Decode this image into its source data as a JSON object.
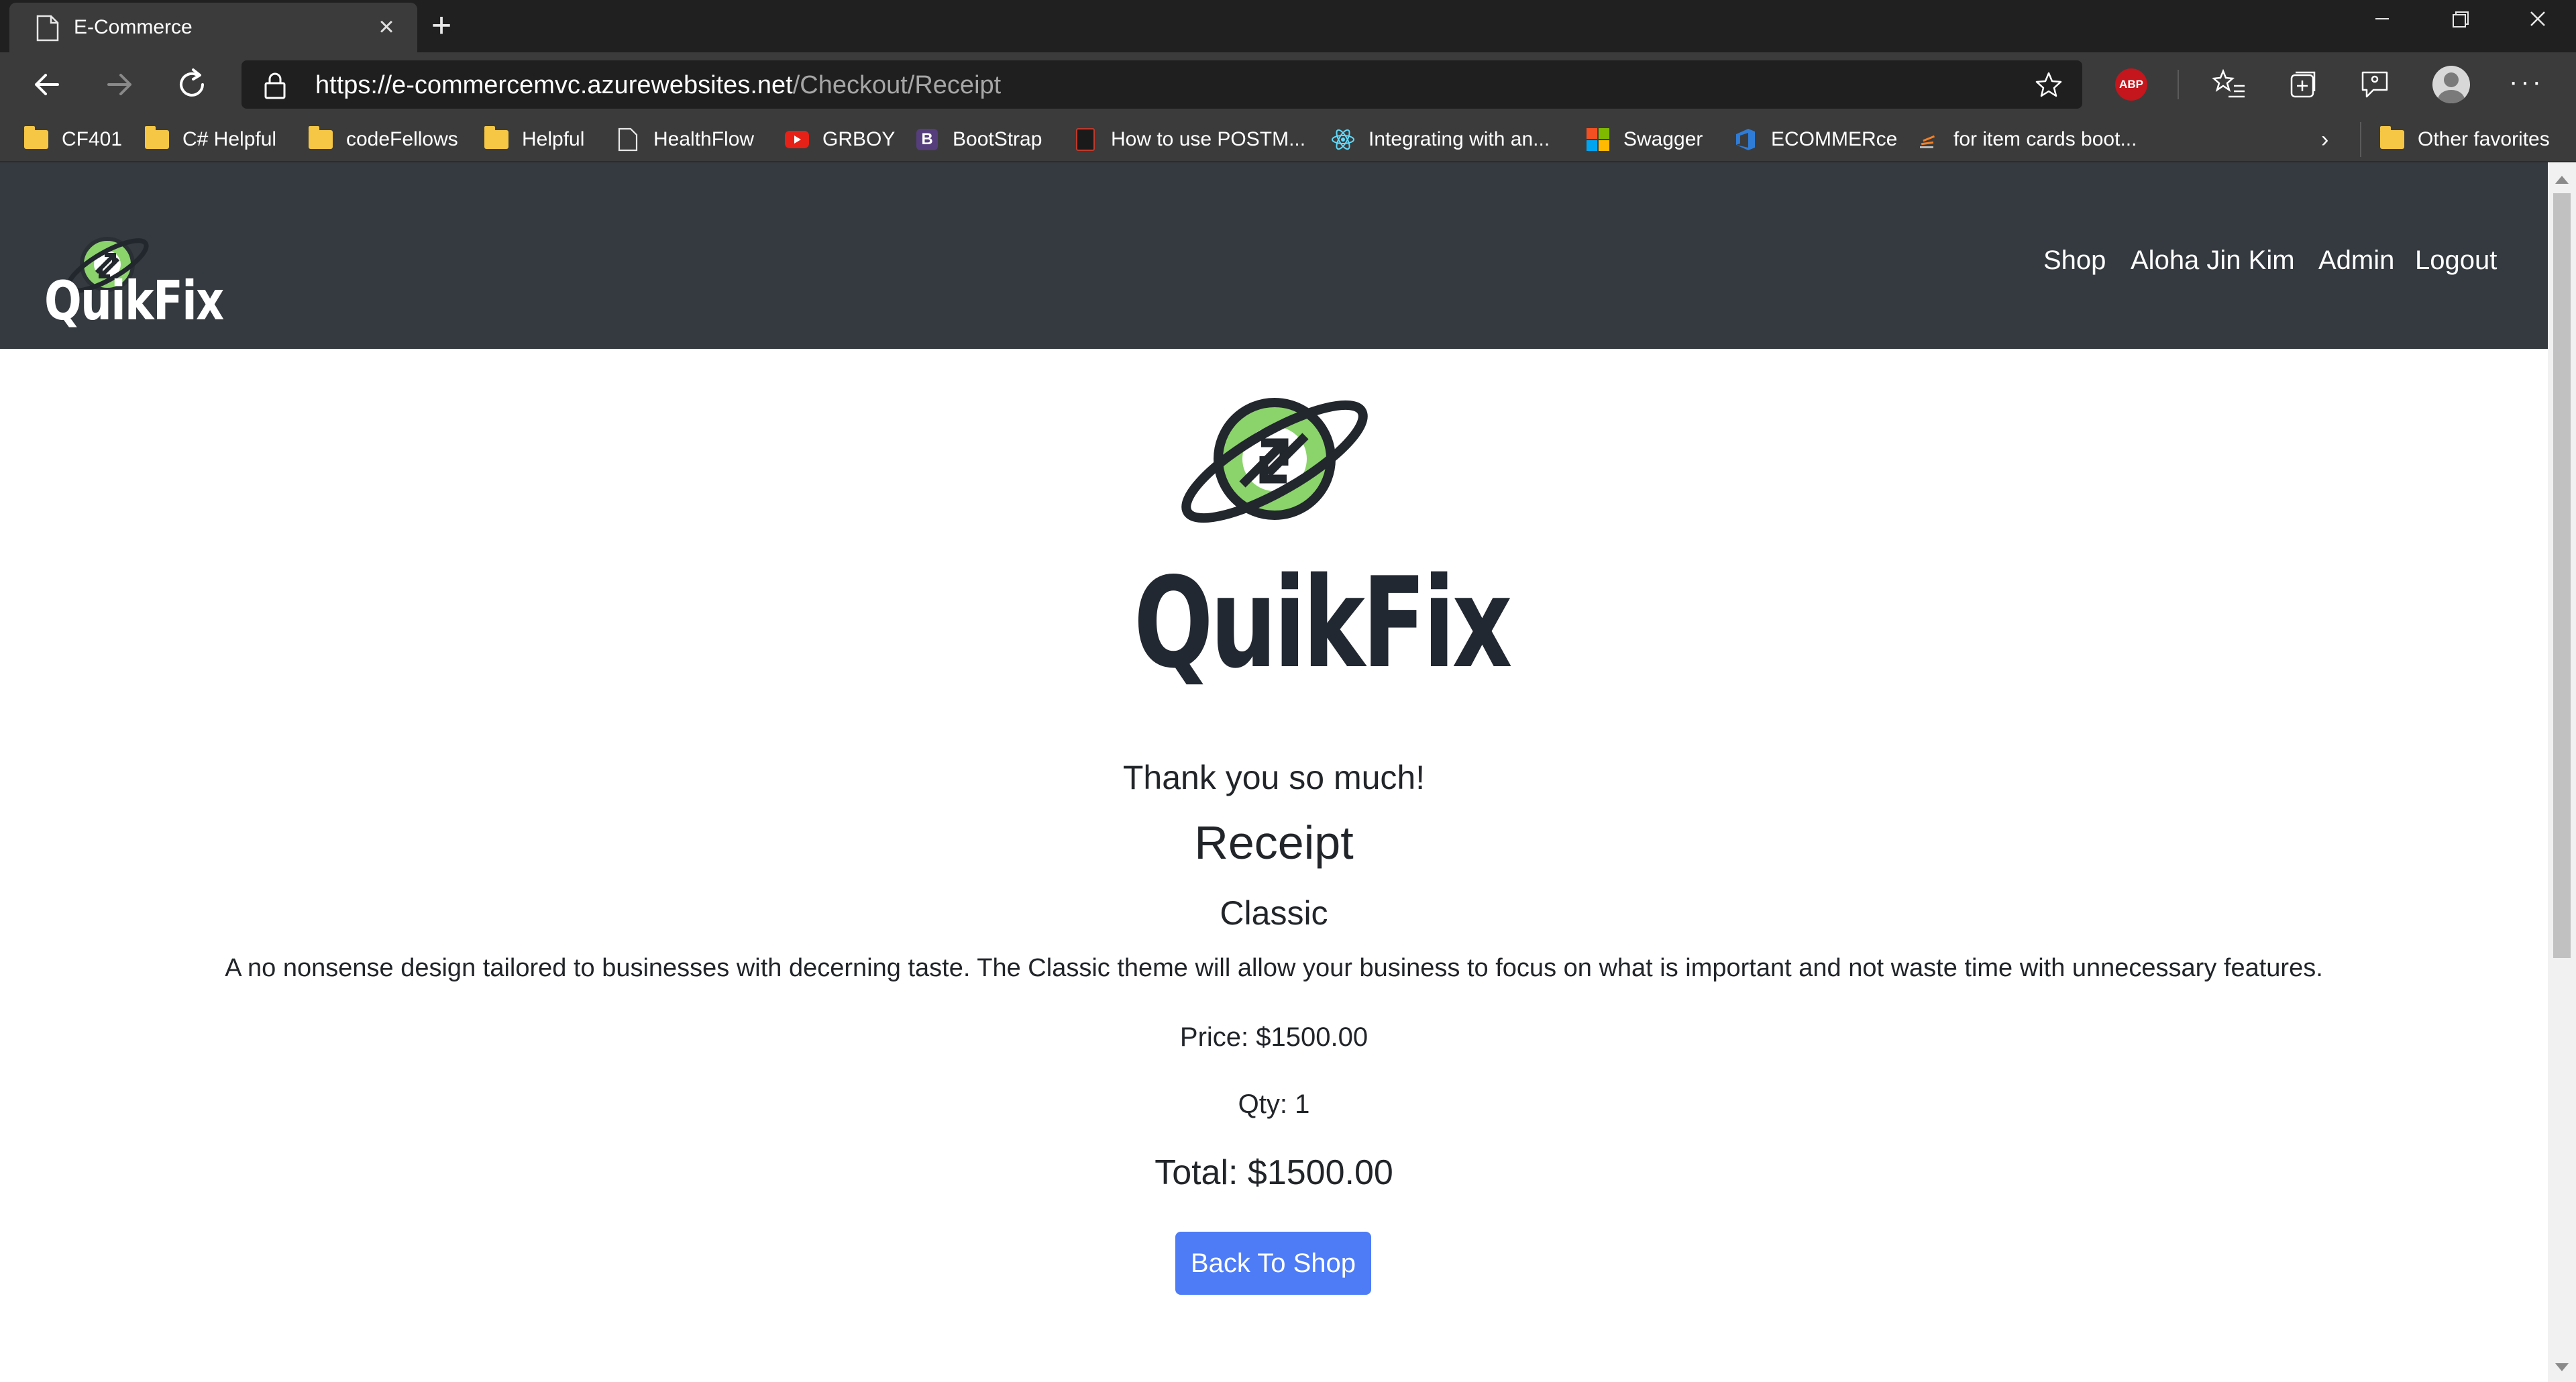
{
  "browser": {
    "tab_title": "E-Commerce",
    "url_host": "https://e-commercemvc.azurewebsites.net",
    "url_path": "/Checkout/Receipt",
    "abp_label": "ABP",
    "favorites": [
      {
        "label": "CF401",
        "icon": "folder-icon"
      },
      {
        "label": "C# Helpful",
        "icon": "folder-icon"
      },
      {
        "label": "codeFellows",
        "icon": "folder-icon"
      },
      {
        "label": "Helpful",
        "icon": "folder-icon"
      },
      {
        "label": "HealthFlow",
        "icon": "page-icon"
      },
      {
        "label": "GRBOY",
        "icon": "youtube-icon"
      },
      {
        "label": "BootStrap",
        "icon": "bootstrap-icon"
      },
      {
        "label": "How to use POSTM...",
        "icon": "site-icon"
      },
      {
        "label": "Integrating with an...",
        "icon": "react-icon"
      },
      {
        "label": "Swagger",
        "icon": "microsoft-icon"
      },
      {
        "label": "ECOMMERce",
        "icon": "azure-devops-icon"
      },
      {
        "label": "for item cards boot...",
        "icon": "stackoverflow-icon"
      }
    ],
    "other_favorites": "Other favorites"
  },
  "site": {
    "brand": "QuikFix",
    "nav": {
      "shop": "Shop",
      "user": "Aloha Jin Kim",
      "admin": "Admin",
      "logout": "Logout"
    }
  },
  "receipt": {
    "thanks": "Thank you so much!",
    "heading": "Receipt",
    "product_name": "Classic",
    "description": "A no nonsense design tailored to businesses with decerning taste. The Classic theme will allow your business to focus on what is important and not waste time with unnecessary features.",
    "price": "Price: $1500.00",
    "qty": "Qty: 1",
    "total": "Total: $1500.00",
    "back_button": "Back To Shop"
  },
  "colors": {
    "navbar": "#343a40",
    "button": "#4e7cf7",
    "logo_green": "#8bd36b"
  }
}
